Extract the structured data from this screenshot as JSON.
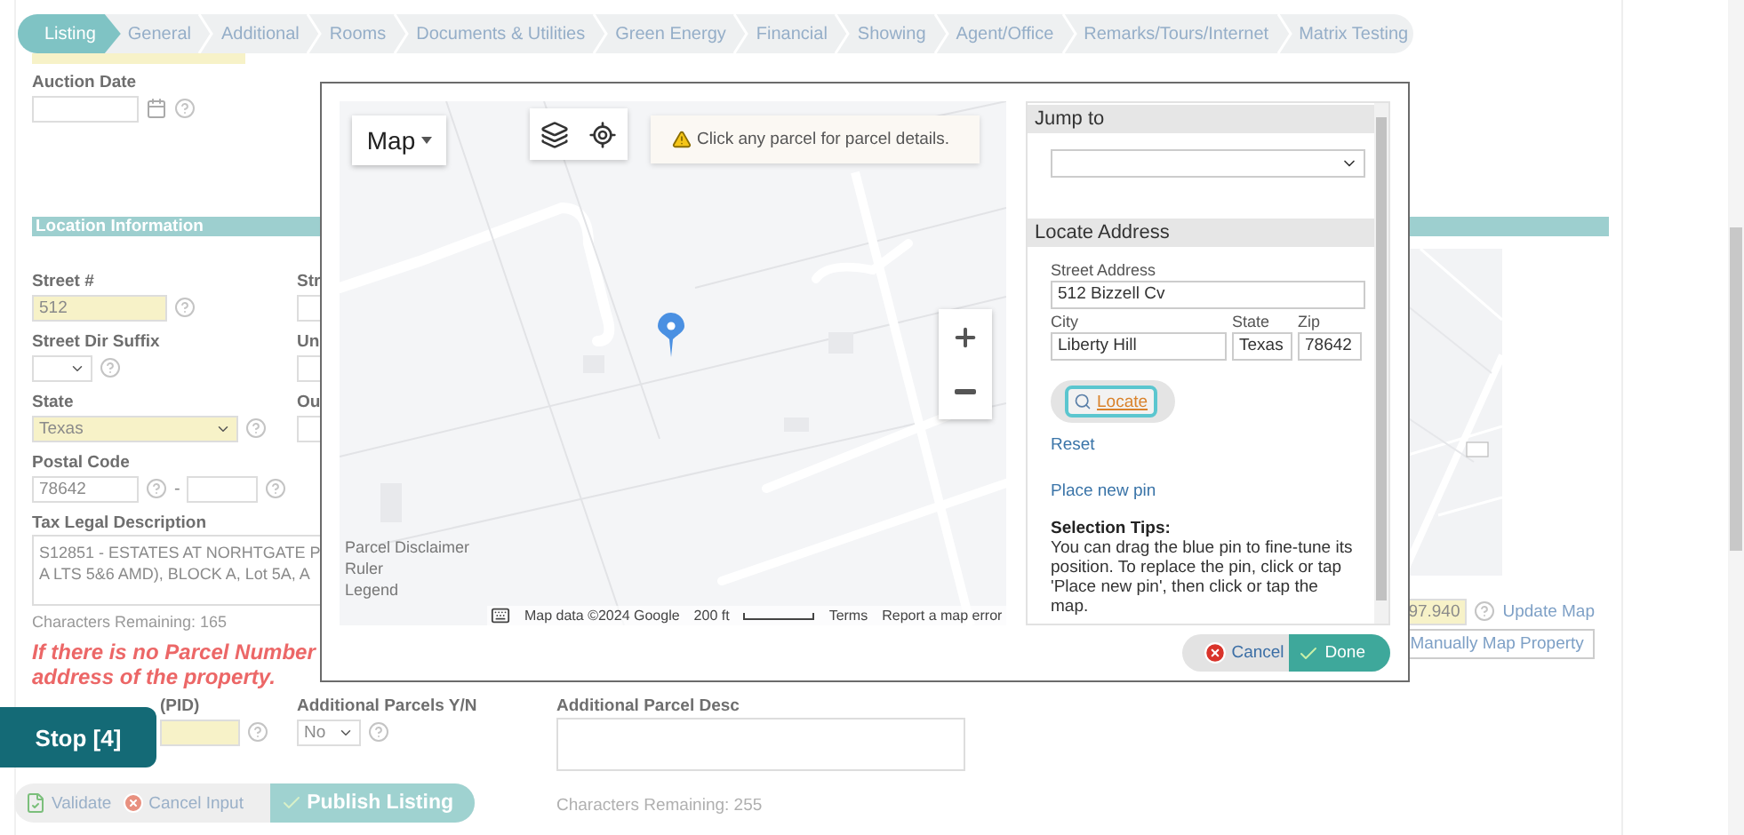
{
  "tabs": [
    {
      "label": "Listing",
      "selected": true
    },
    {
      "label": "General",
      "selected": false
    },
    {
      "label": "Additional",
      "selected": false
    },
    {
      "label": "Rooms",
      "selected": false
    },
    {
      "label": "Documents & Utilities",
      "selected": false
    },
    {
      "label": "Green Energy",
      "selected": false
    },
    {
      "label": "Financial",
      "selected": false
    },
    {
      "label": "Showing",
      "selected": false
    },
    {
      "label": "Agent/Office",
      "selected": false
    },
    {
      "label": "Remarks/Tours/Internet",
      "selected": false
    },
    {
      "label": "Matrix Testing",
      "selected": false
    }
  ],
  "auction_date": {
    "label": "Auction Date"
  },
  "section_title": "Location Information",
  "street_number": {
    "label": "Street #",
    "value": "512"
  },
  "street_dir_suffix": {
    "label": "Street Dir Suffix"
  },
  "state": {
    "label": "State",
    "value": "Texas"
  },
  "postal_code": {
    "label": "Postal Code",
    "value": "78642",
    "separator": "-"
  },
  "column_2_labels": [
    "Str",
    "Un",
    "Ou"
  ],
  "tax_legal_description": {
    "label": "Tax Legal Description",
    "lines": [
      "S12851 - ESTATES AT NORHTGATE P",
      "A LTS 5&6 AMD), BLOCK A, Lot 5A, A"
    ],
    "remaining": "Characters Remaining: 165"
  },
  "parcel_warning": [
    "If there is no Parcel Number",
    "address of the property."
  ],
  "parcel_number": {
    "label": "(PID)"
  },
  "additional_parcels": {
    "label": "Additional Parcels Y/N",
    "value": "No"
  },
  "additional_parcel_desc": {
    "label": "Additional Parcel Desc",
    "remaining": "Characters Remaining: 255"
  },
  "map_panel": {
    "coordinate": "97.940",
    "update_link": "Update Map",
    "manual_button": "Manually Map Property"
  },
  "stop_button": "Stop [4]",
  "action_bar": [
    {
      "label": "Validate",
      "kind": "validate"
    },
    {
      "label": "Cancel Input",
      "kind": "cancel"
    },
    {
      "label": "Publish Listing",
      "kind": "publish"
    }
  ],
  "dialog": {
    "map": {
      "type_button": "Map",
      "notice": "Click any parcel for parcel details.",
      "links": [
        "Parcel Disclaimer",
        "Ruler",
        "Legend"
      ],
      "attribution": "Map data ©2024 Google",
      "scale": "200 ft",
      "terms": "Terms",
      "report": "Report a map error"
    },
    "jump_to": {
      "title": "Jump to"
    },
    "locate": {
      "title": "Locate Address",
      "street_label": "Street Address",
      "street": "512 Bizzell Cv",
      "city_label": "City",
      "city": "Liberty Hill",
      "state_label": "State",
      "state": "Texas",
      "zip_label": "Zip",
      "zip": "78642",
      "button": "Locate",
      "reset": "Reset",
      "place_pin": "Place new pin",
      "tips_title": "Selection Tips:",
      "tips": "You can drag the blue pin to fine-tune its position. To replace the pin, click or tap 'Place new pin', then click or tap the map."
    },
    "buttons": [
      {
        "label": "Cancel",
        "kind": "cancel"
      },
      {
        "label": "Done",
        "kind": "done"
      }
    ]
  }
}
